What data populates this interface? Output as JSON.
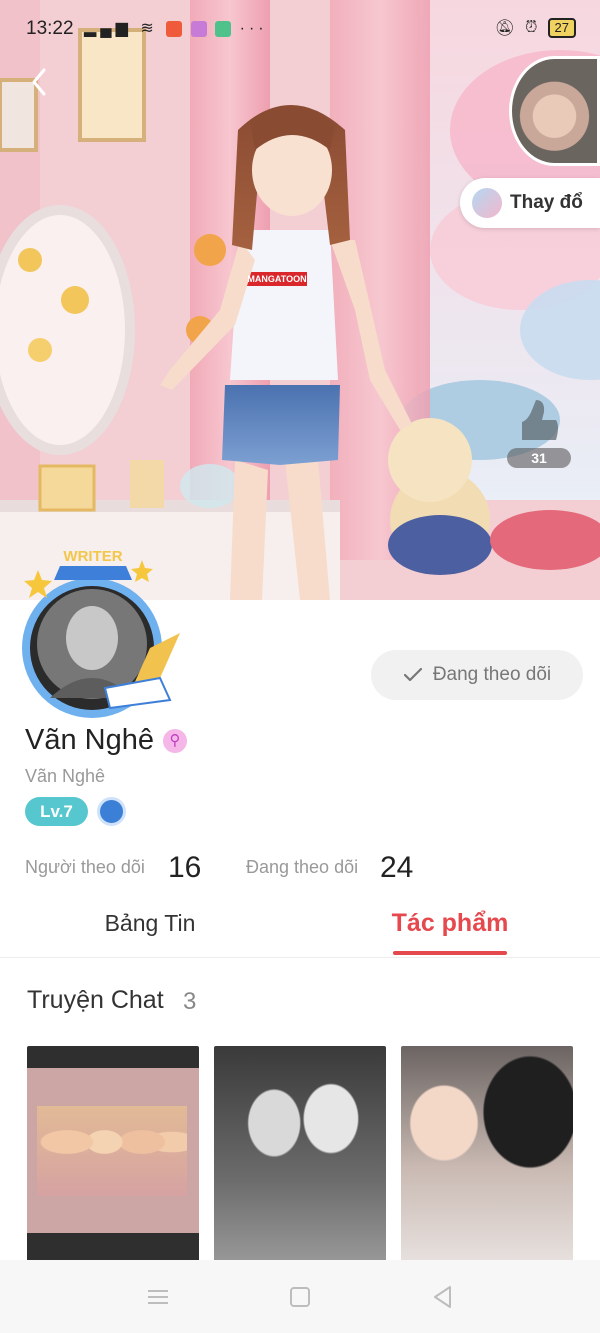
{
  "status_bar": {
    "time": "13:22",
    "battery": "27"
  },
  "header": {
    "change_button_label": "Thay đổ",
    "like_count": "31",
    "shirt_text": "MANGATOON"
  },
  "profile": {
    "writer_badge_text": "WRITER",
    "follow_status_label": "Đang theo dõi",
    "display_name": "Vãn Nghê",
    "username": "Vãn Nghê",
    "level_label": "Lv.7",
    "followers_label": "Người theo dõi",
    "followers_count": "16",
    "following_label": "Đang theo dõi",
    "following_count": "24"
  },
  "tabs": {
    "feed_label": "Bảng Tin",
    "works_label": "Tác phẩm"
  },
  "works": {
    "section_title": "Truyện Chat",
    "section_count": "3"
  },
  "colors": {
    "accent": "#e5484d",
    "level_badge": "#57c7cf"
  }
}
